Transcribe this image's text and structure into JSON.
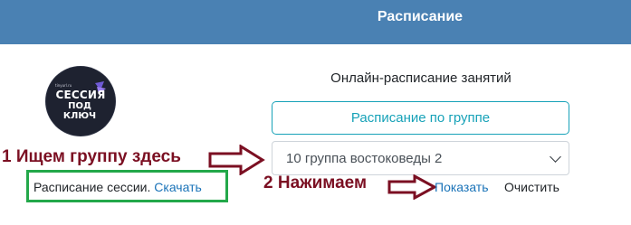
{
  "header": {
    "title": "Расписание"
  },
  "logo": {
    "line1": "СЕССИЯ",
    "line2": "ПОД КЛЮЧ",
    "small": "tinyurl.ru"
  },
  "main": {
    "subtitle": "Онлайн-расписание занятий",
    "group_button": "Расписание по группе",
    "group_select": {
      "selected": "10 группа востоковеды 2"
    },
    "session_label": "Расписание сессии.",
    "download_link": "Скачать",
    "show_button": "Показать",
    "clear_button": "Очистить"
  },
  "annotations": {
    "step1": "1 Ищем группу здесь",
    "step2": "2 Нажимаем"
  },
  "colors": {
    "header_bg": "#4a81b3",
    "accent_teal": "#17a2b8",
    "annotation_red": "#7b0f22",
    "highlight_green": "#23a84a",
    "link_blue": "#1a73b8"
  },
  "icons": {
    "logo": "session-logo",
    "select_chevron": "chevron-down-icon",
    "arrow": "arrow-right-icon"
  }
}
